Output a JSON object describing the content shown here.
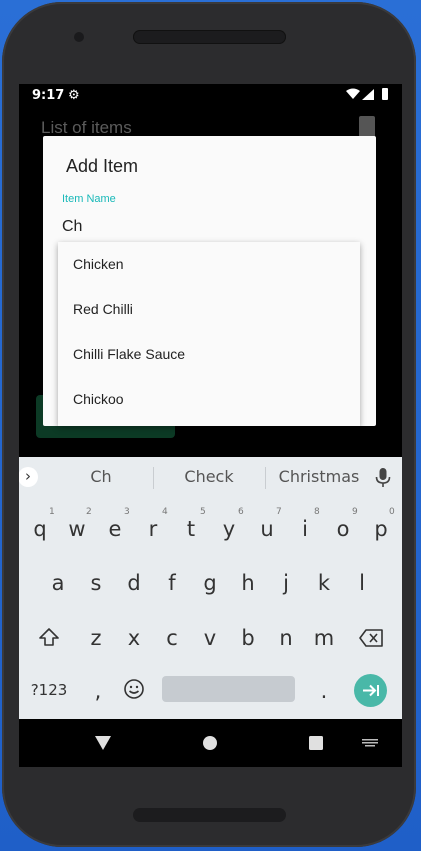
{
  "status_bar": {
    "time": "9:17"
  },
  "app": {
    "title": "List of items"
  },
  "dialog": {
    "title": "Add Item",
    "field_label": "Item Name",
    "field_value": "Ch"
  },
  "dropdown": [
    "Chicken",
    "Red Chilli",
    "Chilli Flake Sauce",
    "Chickoo"
  ],
  "keyboard": {
    "suggestions": [
      "Ch",
      "Check",
      "Christmas"
    ],
    "row1": [
      "q",
      "w",
      "e",
      "r",
      "t",
      "y",
      "u",
      "i",
      "o",
      "p"
    ],
    "row1_nums": [
      "1",
      "2",
      "3",
      "4",
      "5",
      "6",
      "7",
      "8",
      "9",
      "0"
    ],
    "row2": [
      "a",
      "s",
      "d",
      "f",
      "g",
      "h",
      "j",
      "k",
      "l"
    ],
    "row3": [
      "z",
      "x",
      "c",
      "v",
      "b",
      "n",
      "m"
    ],
    "mode_key": "?123",
    "comma": ",",
    "period": "."
  },
  "colors": {
    "accent": "#20c4c4",
    "enter": "#49b8a8",
    "wallpaper": "#2a6fd6"
  }
}
